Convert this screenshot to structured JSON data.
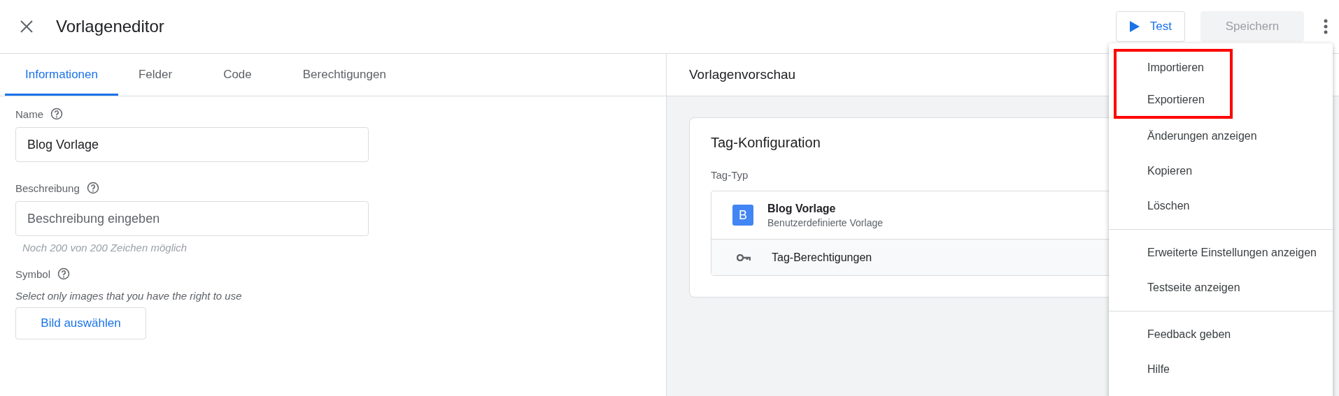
{
  "header": {
    "title": "Vorlageneditor",
    "test_button": "Test",
    "save_button": {
      "label": "Speichern",
      "disabled": true
    }
  },
  "tabs": [
    {
      "label": "Informationen",
      "selected": true
    },
    {
      "label": "Felder",
      "selected": false
    },
    {
      "label": "Code",
      "selected": false
    },
    {
      "label": "Berechtigungen",
      "selected": false
    }
  ],
  "form": {
    "name": {
      "label": "Name",
      "value": "Blog Vorlage"
    },
    "description": {
      "label": "Beschreibung",
      "placeholder": "Beschreibung eingeben",
      "hint": "Noch 200 von 200 Zeichen möglich"
    },
    "symbol": {
      "label": "Symbol",
      "note": "Select only images that you have the right to use",
      "button": "Bild auswählen"
    }
  },
  "preview": {
    "title": "Vorlagenvorschau",
    "card": {
      "title": "Tag-Konfiguration",
      "type_label": "Tag-Typ",
      "template": {
        "badge": "B",
        "name": "Blog Vorlage",
        "subtitle": "Benutzerdefinierte Vorlage"
      },
      "permissions": "Tag-Berechtigungen"
    }
  },
  "menu": {
    "sections": [
      [
        {
          "label": "Importieren",
          "highlighted": true
        },
        {
          "label": "Exportieren",
          "highlighted": true
        },
        {
          "label": "Änderungen anzeigen",
          "highlighted": false
        },
        {
          "label": "Kopieren",
          "highlighted": false
        },
        {
          "label": "Löschen",
          "highlighted": false
        }
      ],
      [
        {
          "label": "Erweiterte Einstellungen anzeigen",
          "highlighted": false
        },
        {
          "label": "Testseite anzeigen",
          "highlighted": false
        }
      ],
      [
        {
          "label": "Feedback geben",
          "highlighted": false
        },
        {
          "label": "Hilfe",
          "highlighted": false
        }
      ]
    ]
  }
}
